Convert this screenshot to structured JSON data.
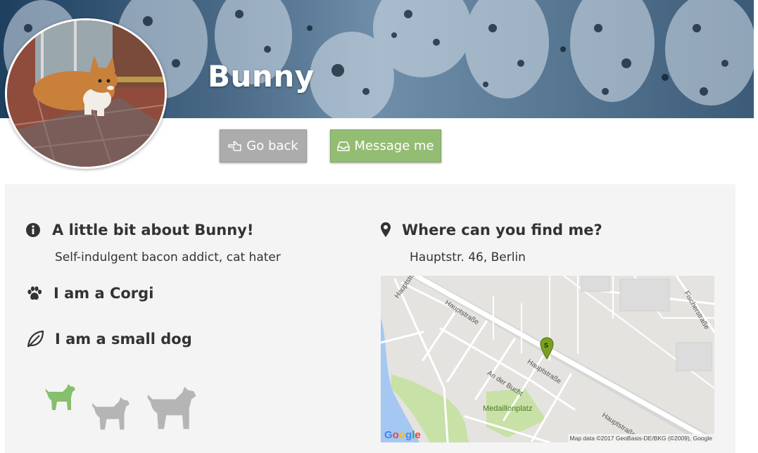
{
  "profile": {
    "name": "Bunny"
  },
  "buttons": {
    "back_label": "Go back",
    "message_label": "Message me"
  },
  "about": {
    "heading": "A little bit about Bunny!",
    "description": "Self-indulgent bacon addict, cat hater",
    "breed": "I am a Corgi",
    "size": "I am a small dog",
    "size_options": [
      "small",
      "medium",
      "large"
    ],
    "selected_size": "small"
  },
  "location": {
    "heading": "Where can you find me?",
    "address": "Hauptstr. 46, Berlin"
  },
  "map": {
    "street_labels": [
      "Hauptstraße",
      "Hauptstraße",
      "Hauptstraße",
      "Hauptstraße",
      "An der Bucht",
      "Fischerstraße"
    ],
    "park_label": "Medaillonplatz",
    "marker_letter": "S",
    "logo": "Google",
    "attribution": "Map data ©2017 GeoBasis-DE/BKG (©2009), Google"
  },
  "colors": {
    "accent_green": "#94bd74",
    "button_gray": "#acacac",
    "selected_size_color": "#86c06c",
    "unselected_size_color": "#b5b5b5",
    "text": "#333333"
  },
  "icons": {
    "about": "info-circle-icon",
    "location": "map-marker-icon",
    "breed": "paw-icon",
    "size": "leaf-icon",
    "back": "hand-point-left-icon",
    "message": "inbox-icon"
  }
}
